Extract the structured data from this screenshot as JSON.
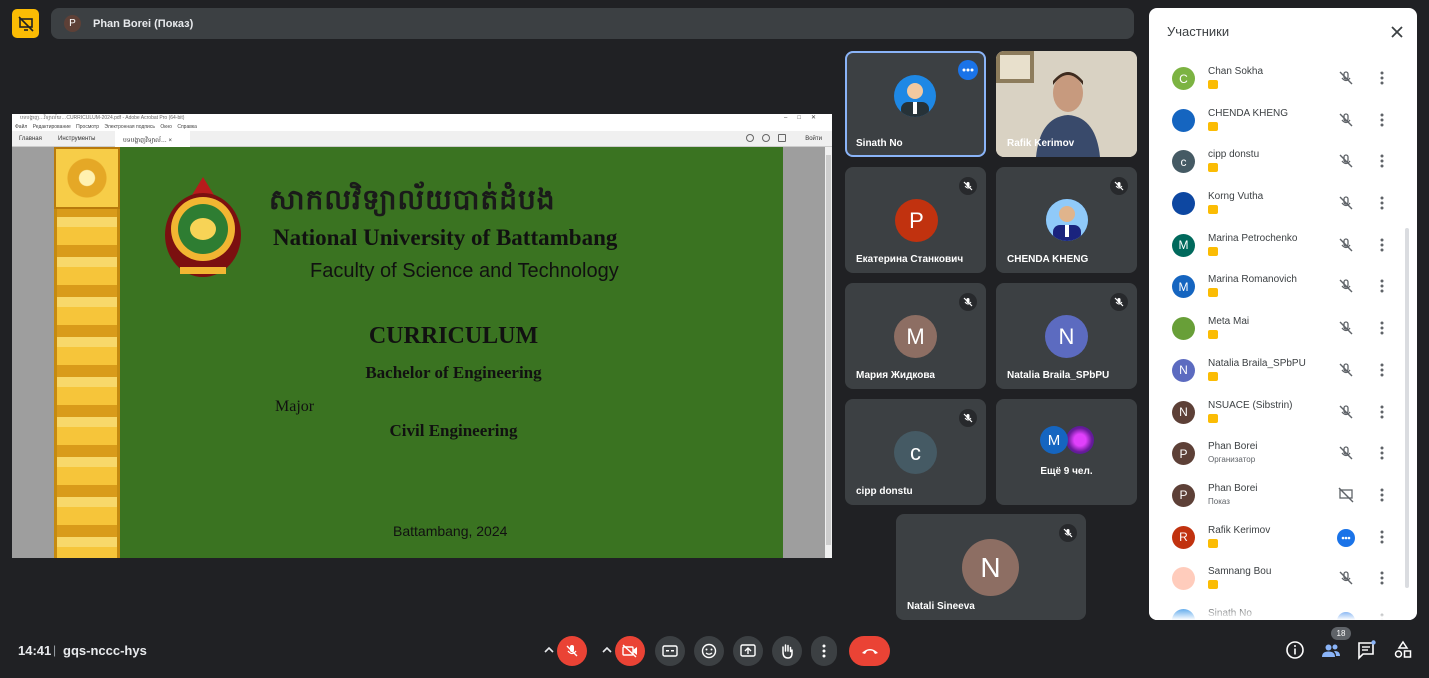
{
  "header": {
    "presenter_avatar_letter": "P",
    "presenter_label": "Phan Borei (Показ)"
  },
  "presentation": {
    "window_title": "បទបង្ហាញ…វិទ្យាល័យ…CURRICULUM-2024.pdf - Adobe Acrobat Pro (64-bit)",
    "menu": [
      "Файл",
      "Редактирование",
      "Просмотр",
      "Электронная подпись",
      "Окно",
      "Справка"
    ],
    "tabs": {
      "home": "Главная",
      "tools": "Инструменты",
      "doc": "បទបង្ហាញវិទ្យាល័…",
      "login": "Войти"
    },
    "slide": {
      "khmer_title": "សាកលវិទ្យាល័យបាត់ដំបង",
      "university": "National University of Battambang",
      "faculty": "Faculty of Science and Technology",
      "heading": "CURRICULUM",
      "degree": "Bachelor of Engineering",
      "major_label": "Major",
      "major": "Civil Engineering",
      "place_year": "Battambang, 2024"
    }
  },
  "tiles": [
    {
      "name": "Sinath No",
      "letter": "",
      "color": "#1e88e5",
      "active": true
    },
    {
      "name": "Rafik Kerimov",
      "letter": "",
      "color": "#a1887f"
    },
    {
      "name": "Екатерина Станкович",
      "letter": "Р",
      "color": "#c1320f"
    },
    {
      "name": "CHENDA KHENG",
      "letter": "",
      "color": "#1565c0"
    },
    {
      "name": "Мария Жидкова",
      "letter": "M",
      "color": "#8d6e63"
    },
    {
      "name": "Natalia Braila_SPbPU",
      "letter": "N",
      "color": "#5c6bc0"
    },
    {
      "name": "cipp donstu",
      "letter": "c",
      "color": "#455a64"
    },
    {
      "name": "Ещё 9 чел.",
      "letter": "M",
      "color": "#1565c0"
    },
    {
      "name": "Natali Sineeva",
      "letter": "N",
      "color": "#8d6e63"
    }
  ],
  "participants_panel": {
    "title": "Участники",
    "people": [
      {
        "name": "Chan Sokha",
        "letter": "C",
        "color": "#7cb342",
        "sub": "",
        "state": "muted"
      },
      {
        "name": "CHENDA KHENG",
        "letter": "",
        "color": "#1565c0",
        "sub": "",
        "state": "muted"
      },
      {
        "name": "cipp donstu",
        "letter": "c",
        "color": "#455a64",
        "sub": "",
        "state": "muted"
      },
      {
        "name": "Korng Vutha",
        "letter": "",
        "color": "#0d47a1",
        "sub": "",
        "state": "muted"
      },
      {
        "name": "Marina Petrochenko",
        "letter": "M",
        "color": "#00695c",
        "sub": "",
        "state": "muted"
      },
      {
        "name": "Marina Romanovich",
        "letter": "M",
        "color": "#1565c0",
        "sub": "",
        "state": "muted"
      },
      {
        "name": "Meta Mai",
        "letter": "",
        "color": "#689f38",
        "sub": "",
        "state": "muted"
      },
      {
        "name": "Natalia Braila_SPbPU",
        "letter": "N",
        "color": "#5c6bc0",
        "sub": "",
        "state": "muted"
      },
      {
        "name": "NSUACE (Sibstrin)",
        "letter": "N",
        "color": "#5d4037",
        "sub": "",
        "state": "muted"
      },
      {
        "name": "Phan Borei",
        "letter": "P",
        "color": "#5d4037",
        "sub": "Организатор",
        "state": "muted"
      },
      {
        "name": "Phan Borei",
        "letter": "P",
        "color": "#5d4037",
        "sub": "Показ",
        "state": "presenting"
      },
      {
        "name": "Rafik Kerimov",
        "letter": "R",
        "color": "#c1320f",
        "sub": "",
        "state": "speaking"
      },
      {
        "name": "Samnang Bou",
        "letter": "",
        "color": "#ffccbc",
        "sub": "",
        "state": "muted"
      },
      {
        "name": "Sinath No",
        "letter": "",
        "color": "#1e88e5",
        "sub": "",
        "state": "speaking"
      }
    ]
  },
  "bottom_bar": {
    "time": "14:41",
    "separator": "|",
    "meeting_code": "gqs-nccc-hys",
    "participant_count": "18"
  },
  "colors": {
    "background": "#202124",
    "tile": "#3c4043",
    "end_call": "#ea4335",
    "accent": "#1a73e8",
    "slide_green": "#3a7321"
  }
}
